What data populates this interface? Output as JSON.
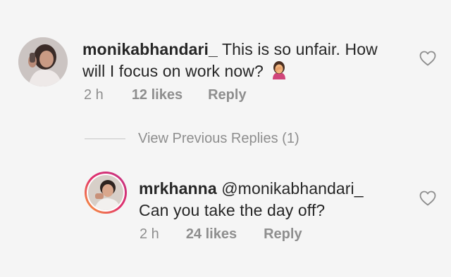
{
  "comment": {
    "username": "monikabhandari_",
    "text_line1": "This is so unfair. How",
    "text_line2": "will I focus on work now?",
    "emoji": "🤦‍♀️",
    "time": "2 h",
    "likes": "12 likes",
    "reply_label": "Reply"
  },
  "view_previous_replies": "View Previous Replies (1)",
  "reply": {
    "username": "mrkhanna",
    "mention": "@monikabhandari_",
    "text": "Can you take the day off?",
    "time": "2 h",
    "likes": "24 likes",
    "reply_label": "Reply"
  },
  "colors": {
    "background": "#f5f5f5",
    "text": "#262626",
    "meta": "#8e8e8e",
    "story_ring": "#e1306c"
  },
  "icons": [
    "heart-outline-icon",
    "facepalm-emoji-icon"
  ]
}
